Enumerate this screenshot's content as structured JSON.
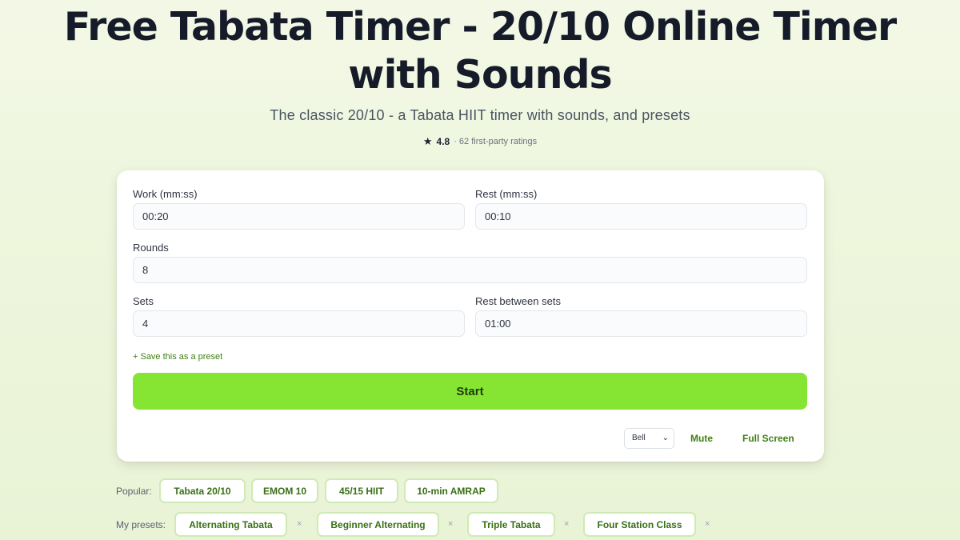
{
  "header": {
    "title_line1": "Free Tabata Timer - 20/10 Online Timer",
    "title_line2": "with Sounds",
    "subtitle": "The classic 20/10 - a Tabata HIIT timer with sounds, and presets",
    "rating": {
      "star_icon": "★",
      "score": "4.8",
      "count_text": "· 62 first-party ratings"
    }
  },
  "form": {
    "work": {
      "label": "Work (mm:ss)",
      "value": "00:20"
    },
    "rest": {
      "label": "Rest (mm:ss)",
      "value": "00:10"
    },
    "rounds": {
      "label": "Rounds",
      "value": "8"
    },
    "sets": {
      "label": "Sets",
      "value": "4"
    },
    "rest_between_sets": {
      "label": "Rest between sets",
      "value": "01:00"
    },
    "save_preset_link": "+ Save this as a preset",
    "start_label": "Start",
    "sound": {
      "selected": "Bell",
      "chevron": "⌄"
    },
    "mute_label": "Mute",
    "fullscreen_label": "Full Screen"
  },
  "popular": {
    "label": "Popular:",
    "items": [
      "Tabata 20/10",
      "EMOM 10",
      "45/15 HIIT",
      "10-min AMRAP"
    ]
  },
  "my_presets": {
    "label": "My presets:",
    "remove_glyph": "×",
    "items": [
      "Alternating Tabata",
      "Beginner Alternating",
      "Triple Tabata",
      "Four Station Class"
    ]
  },
  "colors": {
    "accent": "#86e532",
    "link_green": "#3f7f12",
    "background": "#eef6dd"
  }
}
